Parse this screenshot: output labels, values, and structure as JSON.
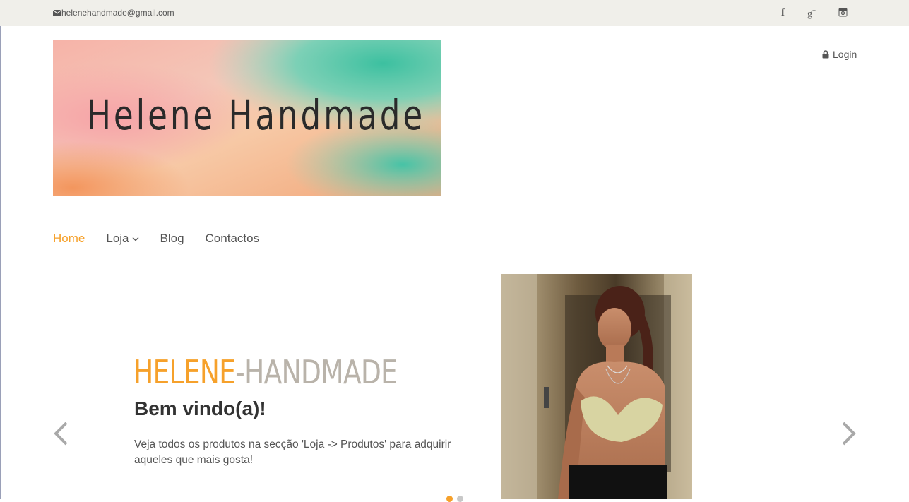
{
  "topbar": {
    "email": "helenehandmade@gmail.com",
    "social": [
      {
        "icon": "facebook-icon",
        "glyph": "f"
      },
      {
        "icon": "google-plus-icon",
        "glyph": "g"
      },
      {
        "icon": "instagram-icon"
      }
    ]
  },
  "header": {
    "banner_title": "Helene Handmade",
    "login_label": "Login"
  },
  "nav": {
    "items": [
      {
        "label": "Home",
        "active": true
      },
      {
        "label": "Loja",
        "has_dropdown": true
      },
      {
        "label": "Blog"
      },
      {
        "label": "Contactos"
      }
    ]
  },
  "slider": {
    "brand_part1": "HELENE",
    "brand_part2": "-HANDMADE",
    "heading": "Bem vindo(a)!",
    "text": "Veja todos os produtos na secção 'Loja -> Produtos' para adquirir aqueles que mais gosta!",
    "prev_icon": "chevron-left-icon",
    "next_icon": "chevron-right-icon",
    "active_slide": 1,
    "total_slides": 2
  },
  "colors": {
    "accent": "#f6a12b",
    "topbar_bg": "#f0efea",
    "brand_gray": "#b9b3aa"
  }
}
